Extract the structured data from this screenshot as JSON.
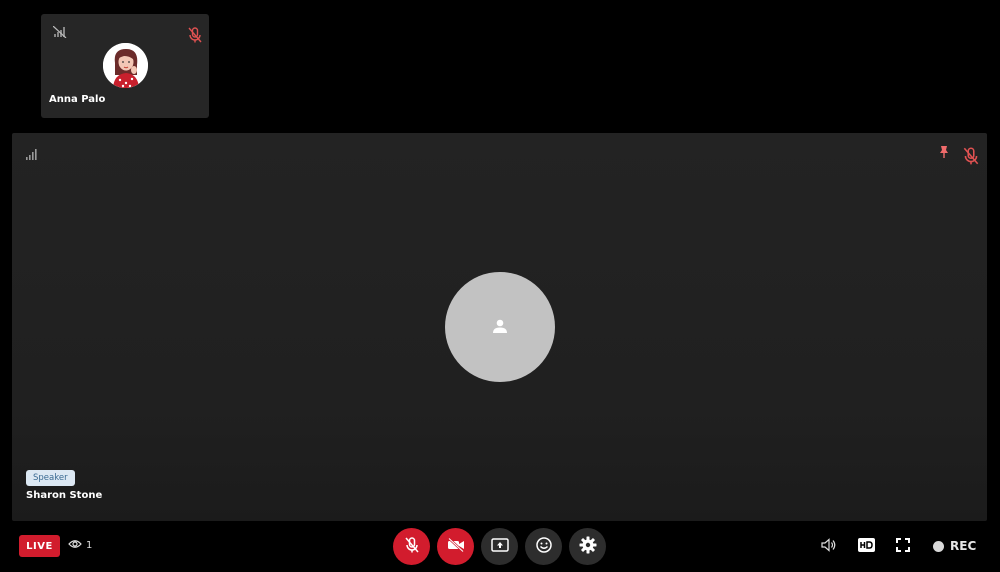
{
  "participants": {
    "thumbnail": {
      "name": "Anna Palo",
      "mic_muted": true
    },
    "stage": {
      "name": "Sharon Stone",
      "role_badge": "Speaker",
      "mic_muted": true,
      "pinned": true
    }
  },
  "status": {
    "live_label": "LIVE",
    "viewer_count": "1",
    "rec_label": "REC"
  },
  "controls": {
    "icons": [
      "mic-off-icon",
      "video-off-icon",
      "screen-share-icon",
      "emoji-icon",
      "settings-icon"
    ]
  },
  "colors": {
    "accent_red": "#d21c2d",
    "badge_bg": "#dce8f3",
    "avatar_placeholder": "#c2c2c2"
  }
}
